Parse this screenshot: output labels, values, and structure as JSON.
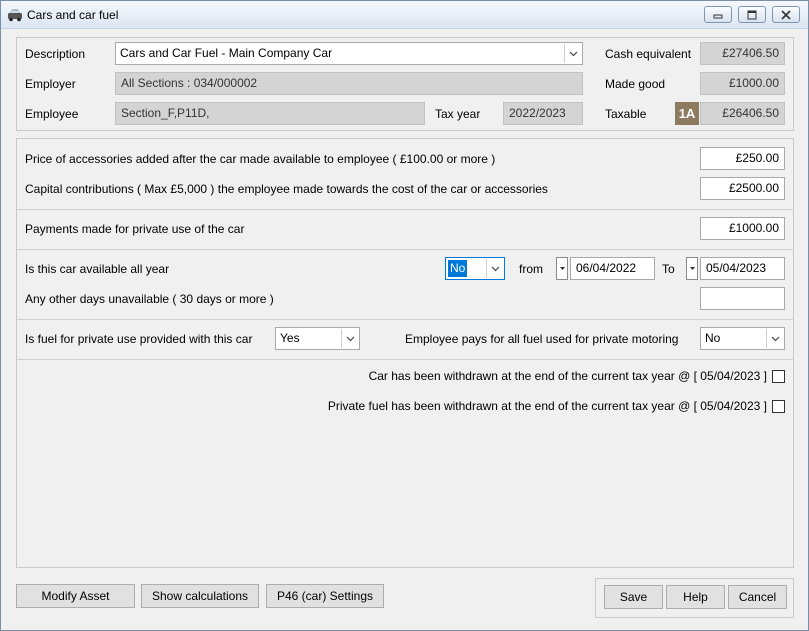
{
  "window": {
    "title": "Cars and car fuel"
  },
  "header": {
    "description_label": "Description",
    "description_value": "Cars and Car Fuel - Main Company Car",
    "employer_label": "Employer",
    "employer_value": "All Sections : 034/000002",
    "employee_label": "Employee",
    "employee_value": "Section_F,P11D,",
    "tax_year_label": "Tax year",
    "tax_year_value": "2022/2023",
    "cash_equivalent_label": "Cash equivalent",
    "cash_equivalent_value": "£27406.50",
    "made_good_label": "Made good",
    "made_good_value": "£1000.00",
    "taxable_label": "Taxable",
    "taxable_badge": "1A",
    "taxable_value": "£26406.50"
  },
  "accessories": {
    "price_label": "Price of accessories added after the car made available to employee ( £100.00 or  more )",
    "price_value": "£250.00",
    "capital_label": "Capital contributions ( Max £5,000 ) the employee made towards the cost of the car or accessories",
    "capital_value": "£2500.00"
  },
  "payments": {
    "label": "Payments made for private use of the car",
    "value": "£1000.00"
  },
  "availability": {
    "all_year_label": "Is this car available all year",
    "all_year_value": "No",
    "from_label": "from",
    "from_value": "06/04/2022",
    "to_label": "To",
    "to_value": "05/04/2023",
    "other_days_label": "Any other days unavailable ( 30 days or more )",
    "other_days_value": ""
  },
  "fuel": {
    "provided_label": "Is fuel for private use provided with this car",
    "provided_value": "Yes",
    "employee_pays_label": "Employee pays for all fuel used for private motoring",
    "employee_pays_value": "No"
  },
  "withdrawn": {
    "car_label": "Car has been withdrawn at the end of the current tax year @ [ 05/04/2023 ]",
    "fuel_label": "Private fuel has been withdrawn at the end of the current tax year @ [ 05/04/2023 ]"
  },
  "buttons": {
    "modify_asset": "Modify Asset",
    "show_calculations": "Show calculations",
    "p46_settings": "P46 (car) Settings",
    "save": "Save",
    "help": "Help",
    "cancel": "Cancel"
  }
}
